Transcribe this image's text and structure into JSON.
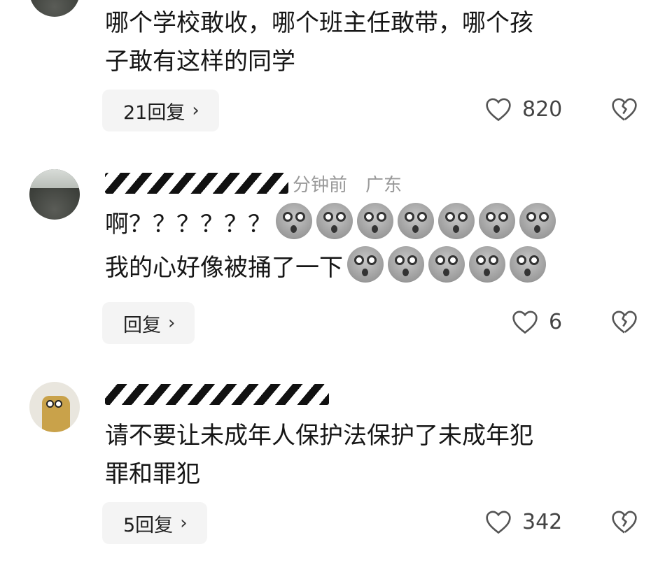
{
  "comments": [
    {
      "text_lines": [
        "哪个学校敢收，哪个班主任敢带，哪个孩",
        "子敢有这样的同学"
      ],
      "reply_label": "21回复",
      "likes": "820"
    },
    {
      "meta_time": "分钟前",
      "meta_location": "广东",
      "line1": "啊？？？？？？",
      "line2": "我的心好像被捅了一下",
      "emoji_name": "shocked-face-emoji",
      "emoji_line1_count": 7,
      "emoji_line2_count": 5,
      "reply_label": "回复",
      "likes": "6"
    },
    {
      "text_lines": [
        "请不要让未成年人保护法保护了未成年犯",
        "罪和罪犯"
      ],
      "reply_label": "5回复",
      "likes": "342"
    }
  ],
  "icons": {
    "like": "heart-outline-icon",
    "dislike": "broken-heart-icon",
    "reply_chevron": "chevron-right-icon"
  },
  "colors": {
    "reply_bg": "#f4f4f4",
    "meta_text": "#9a9a9a",
    "body_text": "#161616"
  }
}
